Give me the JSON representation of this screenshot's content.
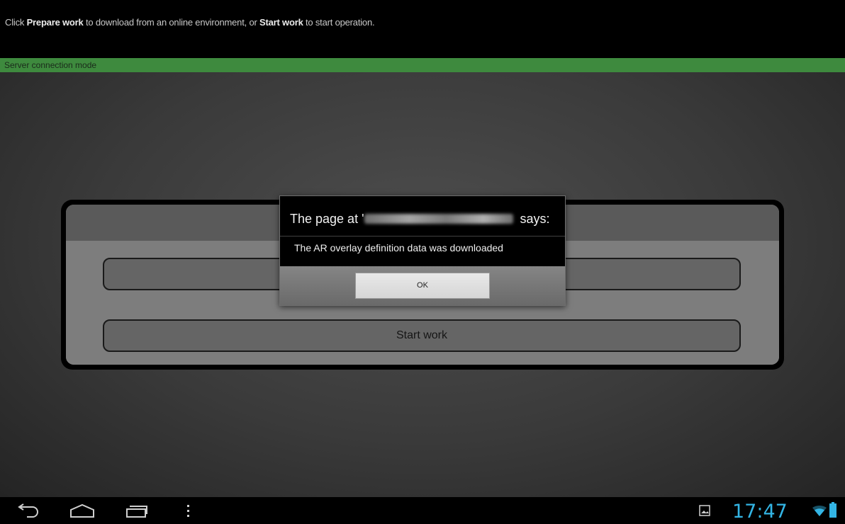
{
  "topbar": {
    "msg_1": "Click ",
    "prepare_label": "Prepare work",
    "msg_2": " to download from an online environment, or ",
    "start_label": "Start work",
    "msg_3": " to start operation."
  },
  "mode_label": "Server connection mode",
  "panel": {
    "start_button_label": "Start work"
  },
  "dialog": {
    "title_prefix": "The page at '",
    "title_suffix": " says:",
    "message": "The AR overlay definition data was downloaded",
    "ok_label": "OK"
  },
  "status": {
    "time": "17:47"
  },
  "colors": {
    "mode_bar": "#3e8a3e",
    "clock": "#33b5e5"
  }
}
